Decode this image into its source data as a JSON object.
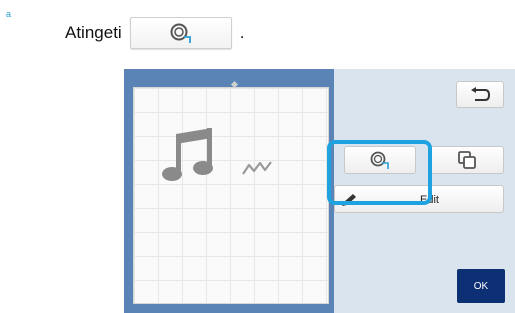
{
  "step": {
    "marker": "a"
  },
  "instruction": {
    "text_before": "Atingeti",
    "text_after": ".",
    "button_icon": "outline-icon"
  },
  "screen": {
    "back_icon": "back-arrow-icon",
    "mat_icons": [
      "music-note-icon",
      "small-notes-icon"
    ],
    "outline_icon": "outline-icon",
    "copy_icon": "copy-layers-icon",
    "edit": {
      "icon": "pencil-icon",
      "label": "Edit"
    },
    "ok_label": "OK",
    "highlighted": "outline-button"
  },
  "colors": {
    "highlight": "#1fa3e0",
    "screen_frame": "#5a84b6",
    "panel": "#d9e4ef",
    "ok_button": "#0d2f73",
    "step_marker": "#2a9fd6"
  }
}
